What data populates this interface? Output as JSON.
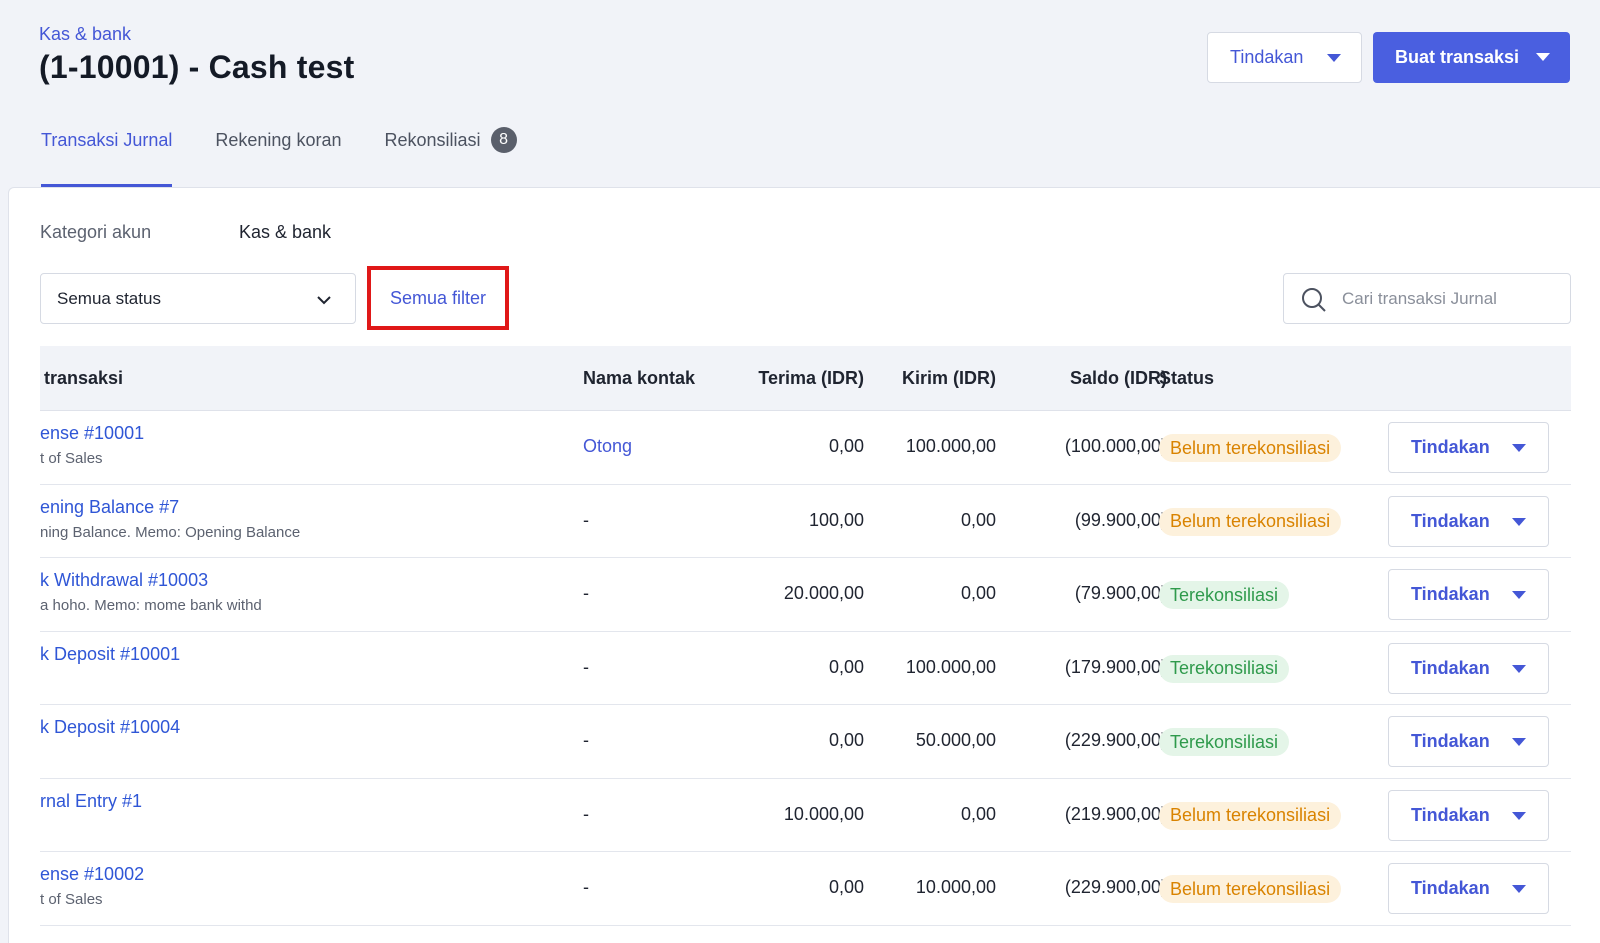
{
  "header": {
    "breadcrumb": "Kas & bank",
    "title": "(1-10001) - Cash test",
    "actions_label": "Tindakan",
    "create_label": "Buat transaksi"
  },
  "tabs": [
    {
      "label": "Transaksi Jurnal",
      "active": true
    },
    {
      "label": "Rekening koran",
      "active": false
    },
    {
      "label": "Rekonsiliasi",
      "active": false,
      "badge": "8"
    }
  ],
  "filters": {
    "category_label": "Kategori akun",
    "category_value": "Kas & bank",
    "status_value": "Semua status",
    "all_filters_label": "Semua filter",
    "search_placeholder": "Cari transaksi Jurnal"
  },
  "table": {
    "columns": [
      "transaksi",
      "Nama kontak",
      "Terima (IDR)",
      "Kirim (IDR)",
      "Saldo (IDR)",
      "Status"
    ],
    "rows": [
      {
        "title": "ense #10001",
        "subtitle": "t of Sales",
        "contact": "Otong",
        "contact_link": true,
        "receive": "0,00",
        "send": "100.000,00",
        "balance": "(100.000,00)",
        "status": "Belum terekonsiliasi",
        "status_type": "pending",
        "action": "Tindakan"
      },
      {
        "title": "ening Balance #7",
        "subtitle": "ning Balance. Memo: Opening Balance",
        "contact": "-",
        "contact_link": false,
        "receive": "100,00",
        "send": "0,00",
        "balance": "(99.900,00)",
        "status": "Belum terekonsiliasi",
        "status_type": "pending",
        "action": "Tindakan"
      },
      {
        "title": "k Withdrawal #10003",
        "subtitle": "a hoho. Memo: mome bank withd",
        "contact": "-",
        "contact_link": false,
        "receive": "20.000,00",
        "send": "0,00",
        "balance": "(79.900,00)",
        "status": "Terekonsiliasi",
        "status_type": "done",
        "action": "Tindakan"
      },
      {
        "title": "k Deposit #10001",
        "subtitle": "",
        "contact": "-",
        "contact_link": false,
        "receive": "0,00",
        "send": "100.000,00",
        "balance": "(179.900,00)",
        "status": "Terekonsiliasi",
        "status_type": "done",
        "action": "Tindakan"
      },
      {
        "title": "k Deposit #10004",
        "subtitle": "",
        "contact": "-",
        "contact_link": false,
        "receive": "0,00",
        "send": "50.000,00",
        "balance": "(229.900,00)",
        "status": "Terekonsiliasi",
        "status_type": "done",
        "action": "Tindakan"
      },
      {
        "title": "rnal Entry #1",
        "subtitle": "",
        "contact": "-",
        "contact_link": false,
        "receive": "10.000,00",
        "send": "0,00",
        "balance": "(219.900,00)",
        "status": "Belum terekonsiliasi",
        "status_type": "pending",
        "action": "Tindakan"
      },
      {
        "title": "ense #10002",
        "subtitle": "t of Sales",
        "contact": "-",
        "contact_link": false,
        "receive": "0,00",
        "send": "10.000,00",
        "balance": "(229.900,00)",
        "status": "Belum terekonsiliasi",
        "status_type": "pending",
        "action": "Tindakan"
      }
    ]
  }
}
